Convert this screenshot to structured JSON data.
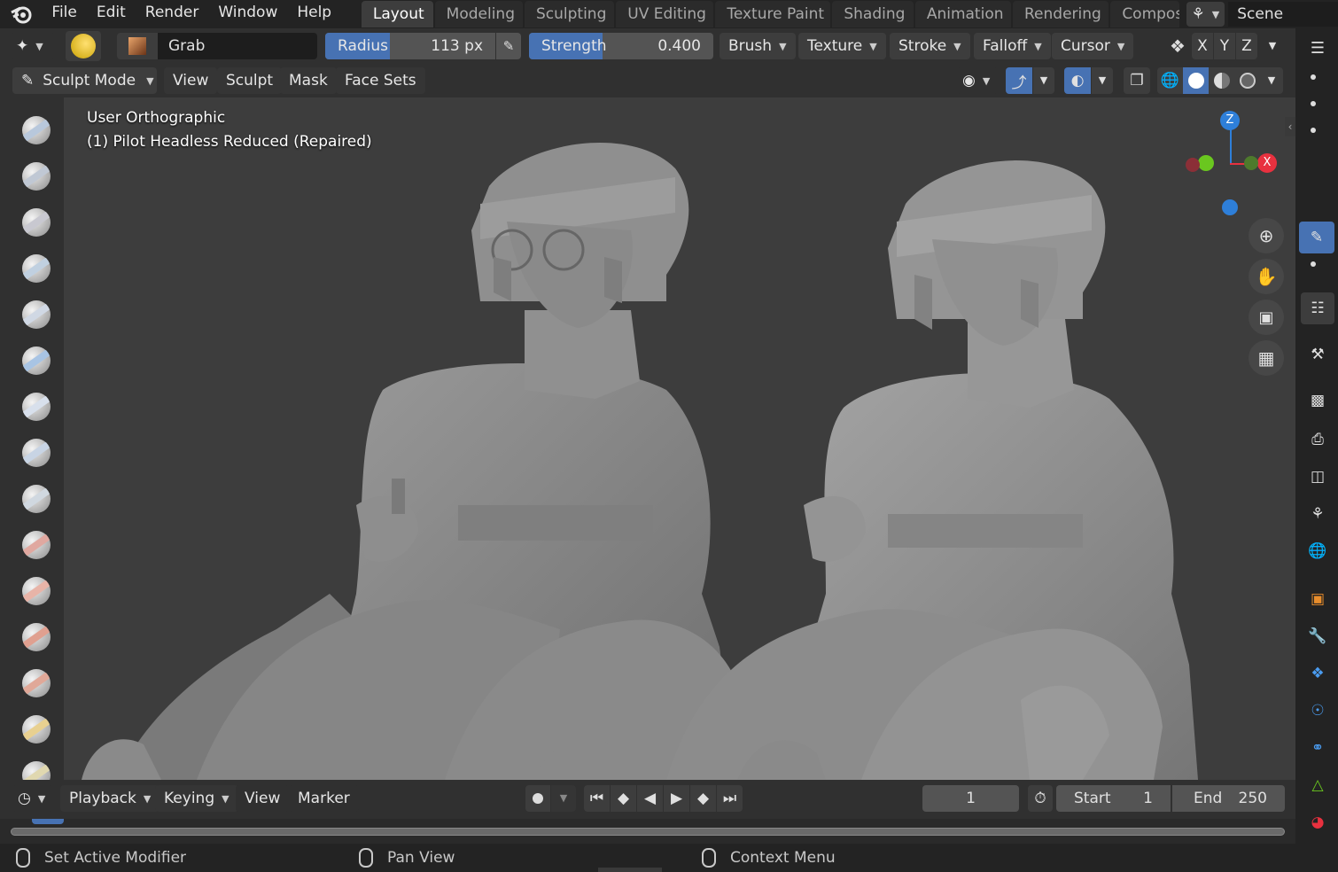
{
  "menu": {
    "items": [
      "File",
      "Edit",
      "Render",
      "Window",
      "Help"
    ]
  },
  "workspaces": {
    "tabs": [
      "Layout",
      "Modeling",
      "Sculpting",
      "UV Editing",
      "Texture Paint",
      "Shading",
      "Animation",
      "Rendering",
      "Compos"
    ],
    "active": "Layout"
  },
  "scene": {
    "label": "Scene"
  },
  "header": {
    "brush_name": "Grab",
    "radius": {
      "label": "Radius",
      "value": "113 px",
      "fill_fraction": 0.38
    },
    "strength": {
      "label": "Strength",
      "value": "0.400",
      "fill_fraction": 0.4
    },
    "dropdowns": [
      "Brush",
      "Texture",
      "Stroke",
      "Falloff",
      "Cursor"
    ],
    "axes": [
      "X",
      "Y",
      "Z"
    ]
  },
  "header2": {
    "mode": "Sculpt Mode",
    "menus": [
      "View",
      "Sculpt",
      "Mask",
      "Face Sets"
    ]
  },
  "viewport": {
    "view_name": "User Orthographic",
    "object_name": "(1) Pilot Headless Reduced (Repaired)",
    "gizmo": {
      "z": "Z",
      "x": "X"
    },
    "colors": {
      "background": "#3d3d3d",
      "mesh": "#8c8c8c",
      "z_axis": "#2e7fd9",
      "x_axis": "#e8313f",
      "y_axis": "#6ac71f"
    }
  },
  "timeline": {
    "menus": [
      "Playback",
      "Keying",
      "View",
      "Marker"
    ],
    "current_frame": "1",
    "start_label": "Start",
    "start_value": "1",
    "end_label": "End",
    "end_value": "250"
  },
  "statusbar": {
    "items": [
      "Set Active Modifier",
      "Pan View",
      "Context Menu"
    ]
  },
  "tools": [
    "draw-brush",
    "draw-sharp-brush",
    "clay-brush",
    "clay-strips-brush",
    "layer-brush",
    "inflate-brush",
    "blob-brush",
    "crease-brush",
    "smooth-brush",
    "flatten-brush",
    "fill-brush",
    "scrape-brush",
    "multiplane-scrape-brush",
    "pinch-brush",
    "grab-brush"
  ]
}
